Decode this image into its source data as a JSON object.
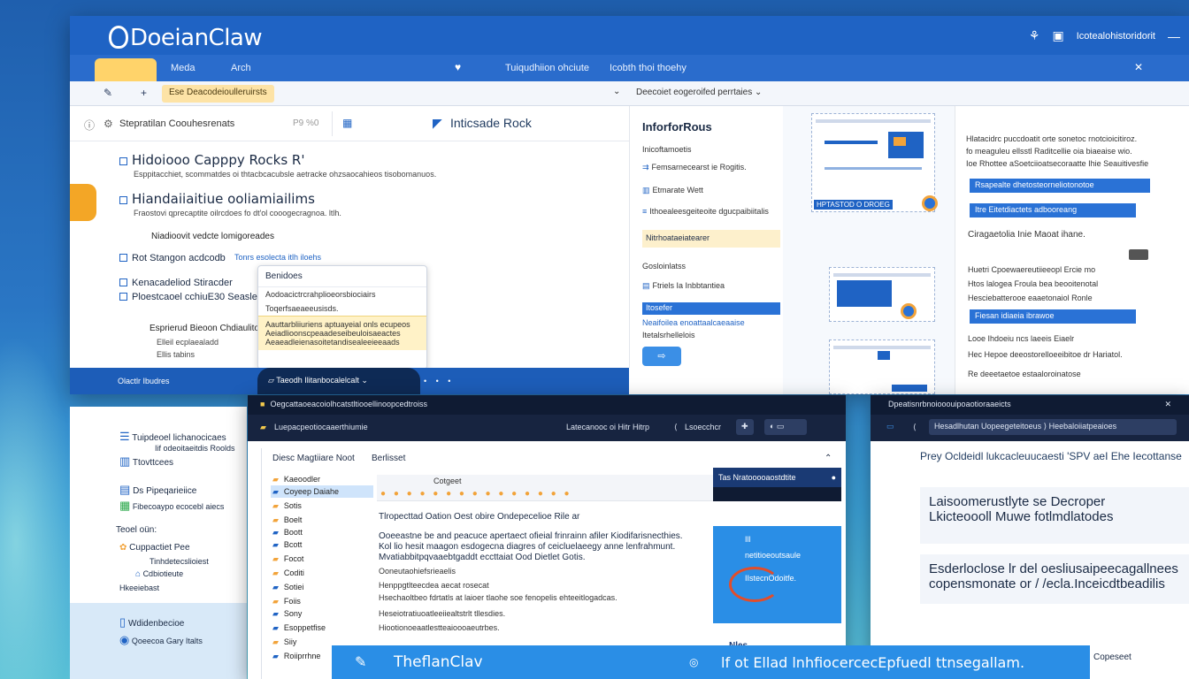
{
  "app": {
    "brand": "DoeianClaw",
    "title_links": [
      "Icotealohistoridorit"
    ],
    "menu": [
      "Meda",
      "Arch",
      "Tuiqudhiion ohciute",
      "Icobth thoi thoehy"
    ]
  },
  "toolbar": {
    "address": "Ese Deacodeioulleruirsts",
    "dropdown_right": "Deecoiet eogeroifed perrtaies"
  },
  "left_pane": {
    "header_title": "Stepratilan Coouhesrenats",
    "header_meta": "P9 %0",
    "header_rock": "Inticsade Rock",
    "items": [
      {
        "title": "Hidoiooo Capppy Rocks R'",
        "desc": "Esppitacchiet, scommatdes oi thtacbcacubsle aetracke ohzsaocahieos tisobomanuos."
      },
      {
        "title": "Hiandaiiaitiue ooliamiailims",
        "desc": "Fraostovi qprecaptite oilrcdoes fo dt'ol cooogecragnoa. ltlh."
      },
      {
        "title": "Niadioovit vedcte lomigoreades"
      },
      {
        "title": "Rot Stangon acdcodb",
        "desc": "Tonrs esolecta itlh iloehs"
      },
      {
        "title": "Kenacadeliod Stiracder"
      },
      {
        "title": "Ploestcaoel cchiuE30 Seaslee"
      },
      {
        "title": "Esprierud Bieoon Chdiaulitoes"
      },
      {
        "title": "Elleil ecplaealadd"
      },
      {
        "title": "Ellis tabins"
      }
    ]
  },
  "popup": {
    "title": "Benidoes",
    "rows": [
      "Aodoacictrcrahplioeorsbiociairs",
      "Toqerfsaeaeeusisds."
    ],
    "highlight": [
      "Aauttarbliiuriens aptuayeial onls ecupeos",
      "Aeiadlioonscpeaadeseibeuloisaeactes",
      "Aeaeadleienasoitetandisealeeieeaads"
    ]
  },
  "info_pane": {
    "title": "InforforRous",
    "rows": [
      "Inicoftamoetis",
      "Femsarnecearst ie Rogitis.",
      "Etmarate Wett",
      "Ithoealeesgeiteoite dgucpaibiitalis",
      "Nitrhoataeiatearer",
      "Gosloinlatss",
      "Ftriels Ia Inbbtantiea",
      "Itosefer",
      "Neaifoilea enoattaalcaeaaise",
      "Itetalsrhellelois"
    ],
    "button": "⇨"
  },
  "thumbs": {
    "caption": "HPTASTOD O DROEG"
  },
  "right_pane": {
    "lines": [
      "Hlatacidrc puccdoatit orte sonetoc rnotcioicitiroz.",
      "fo meaguleu ellsstl Raditcellie oia biaeaise wio.",
      "Ioe Rhottee aSoetciioatsecoraatte Ihie Seauitivesfie"
    ],
    "buttons": [
      "Rsapealte dhetosteorneliotonotoe",
      "Itre Eitetdiactets adbooreang",
      "Fiesan idiaeia ibrawoe"
    ],
    "section": "Ciragaetolia Inie Maoat ihane.",
    "paras": [
      "Huetri Cpoewaereutiieeopl Ercie mo",
      "Htos lalogea Froula bea beooitenotal",
      "Hesciebatterooe eaaetonaiol Ronle",
      "Looe Ihdoeiu ncs laeeis Eiaelr",
      "Hec Hepoe deeostorelloeeibitoe dr Hariatol.",
      "Re deeetaetoe estaaloroinatose"
    ]
  },
  "statusbar": {
    "left": "Olactlr Ibudres",
    "tab": "Taeodh Ilitanbocalelcalt"
  },
  "bottom_left": {
    "rows": [
      "Tuipdeoel lichanocicaes",
      "Iif odeoitaeitdis Roolds",
      "Ttovttcees",
      "Ds Pipeqarieiice",
      "Fibecoaypo ecocebl aiecs",
      "Teoel oün:",
      "Cuppactiet Pee",
      "Tinhdetecslioiest",
      "Cdbiotieute",
      "Hkeeiebast",
      "Wdidenbecioe",
      "Qoeecoa Gary Italts"
    ]
  },
  "editor": {
    "title": "Oegcattaoeacoiolhcatstltiooellinoopcedtroiss",
    "subtitle": "Luepacpeotiocaaerthiumie",
    "nav_center": "Latecanooc oi Hitr Hitrp",
    "nav_right": "Lsoecchcr",
    "tab1": "Diesc Magtiiare Noot",
    "tab2": "Berlisset",
    "ribbon_title": "Cotgeet",
    "side": [
      "Kaeoodler",
      "Coyeep Daiahe",
      "Sotis",
      "Boelt",
      "Boott",
      "Bcott",
      "Focot",
      "Coditi",
      "Sotiei",
      "Foiis",
      "Sony",
      "Esoppetfise",
      "Siiy",
      "Roiiprrhne"
    ],
    "heading": "Tlropecttad Oation Oest obire Ondepecelioe Rile ar",
    "para": [
      "Ooeeastne be and peacuce apertaect ofieial frinrainn afiler Kiodifarisnecthies.",
      "Kol lio hesit maagon esdogecna diagres of ceicluelaeegy anne lenfrahmunt.",
      "Mvatiabbitpqvaaebtgaddt eccttaiat Ood Dietlet Gotis."
    ],
    "small": [
      "Ooneutaohiefsrieaelis",
      "Henppgtlteecdea aecat rosecat",
      "Hsechaoltbeo fdrtatls at laioer tlaohe soe fenopelis ehteeitlogadcas.",
      "Heseiotratiuoatleeiiealtstrlt tllesdies.",
      "Hiootionoeaatlestteaioooaeutrbes."
    ],
    "right_head": "Tas Nratooooaostdtite",
    "right_lines": [
      "Ill",
      "netitioeoutsaule",
      "IIstecnOdoitfe."
    ],
    "right_foot": "Nles"
  },
  "right_bottom": {
    "title": "Dpeatisnrbnoiooouipoaotioraaeicts",
    "addr": "Hesadlhutan Uopeegeteitoeus",
    "addr2": "Heebaloiiatpeaioes",
    "heading": "Prey Ocldeidl lukcacleuucaesti 'SPV aeI Ehe Iecottanse",
    "card1": [
      "Laisoomerustlyte  se Decroper",
      "Lkicteoooll Muwe  fotlmdlatodes"
    ],
    "card2": [
      "Esderloclose  lr del oesliusaipeecagallnees",
      "copensmonate or / /ecla.Inceicdtbeadilis"
    ],
    "corner": "Copeseet"
  },
  "banner": {
    "left": "TheflanClav",
    "right": "lf ot Ellad lnhfiocercecEpfuedl ttnsegallam."
  }
}
